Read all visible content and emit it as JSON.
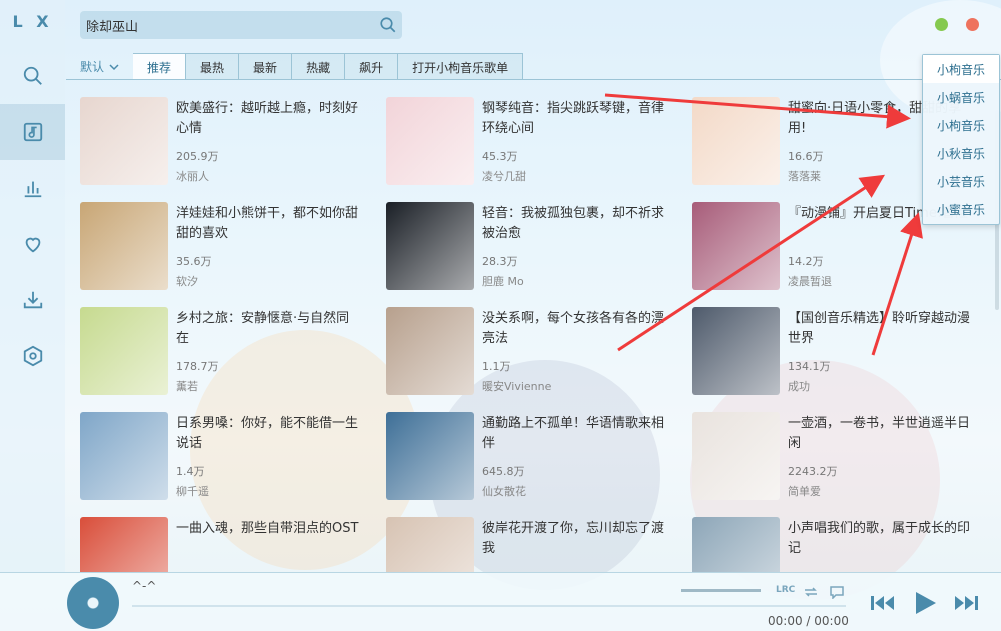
{
  "app": {
    "logo": "L X"
  },
  "search": {
    "value": "除却巫山"
  },
  "tabs": {
    "sort_label": "默认",
    "items": [
      "推荐",
      "最热",
      "最新",
      "热藏",
      "飙升",
      "打开小枸音乐歌单"
    ]
  },
  "source_menu": [
    "小枸音乐",
    "小蜗音乐",
    "小枸音乐",
    "小秋音乐",
    "小芸音乐",
    "小蜜音乐"
  ],
  "playlists": [
    {
      "title": "欧美盛行：越听越上瘾，时刻好心情",
      "count": "205.9万",
      "author": "冰丽人",
      "color": "#e7d6cf"
    },
    {
      "title": "钢琴纯音：指尖跳跃琴键，音律环绕心间",
      "count": "45.3万",
      "author": "凌兮几甜",
      "color": "#f2d4d9"
    },
    {
      "title": "甜蜜向·日语小零食，甜甜的享用!",
      "count": "16.6万",
      "author": "落落莱",
      "color": "#f3d9c7"
    },
    {
      "title": "洋娃娃和小熊饼干，都不如你甜甜的喜欢",
      "count": "35.6万",
      "author": "软汐",
      "color": "#c8a675"
    },
    {
      "title": "轻音：我被孤独包裹，却不祈求被治愈",
      "count": "28.3万",
      "author": "胆鹿 Mo",
      "color": "#1a1f26"
    },
    {
      "title": "『动漫铺』开启夏日Time!冒险",
      "count": "14.2万",
      "author": "凌晨暂退",
      "color": "#a75c79"
    },
    {
      "title": "乡村之旅：安静惬意·与自然同在",
      "count": "178.7万",
      "author": "薰若",
      "color": "#c6da8f"
    },
    {
      "title": "没关系啊，每个女孩各有各的漂亮法",
      "count": "1.1万",
      "author": "暖安Vivienne",
      "color": "#b7a08d"
    },
    {
      "title": "【国创音乐精选】聆听穿越动漫世界",
      "count": "134.1万",
      "author": "成功",
      "color": "#4e5a6b"
    },
    {
      "title": "日系男嗓：你好，能不能借一生说话",
      "count": "1.4万",
      "author": "柳千遥",
      "color": "#7fa6c8"
    },
    {
      "title": "通勤路上不孤单！华语情歌来相伴",
      "count": "645.8万",
      "author": "仙女散花",
      "color": "#3e6f97"
    },
    {
      "title": "一壶酒，一卷书，半世逍遥半日闲",
      "count": "2243.2万",
      "author": "简单爱",
      "color": "#e9e3de"
    },
    {
      "title": "一曲入魂，那些自带泪点的OST",
      "count": "",
      "author": "",
      "color": "#d94e3a"
    },
    {
      "title": "彼岸花开渡了你，忘川却忘了渡我",
      "count": "",
      "author": "",
      "color": "#d7c3b3"
    },
    {
      "title": "小声唱我们的歌，属于成长的印记",
      "count": "",
      "author": "",
      "color": "#8da6b8"
    }
  ],
  "player": {
    "song": "^-^",
    "time": "00:00 / 00:00",
    "lrc_label": "LRC"
  },
  "colors": {
    "accent": "#4a8bab",
    "annotation": "#ef3b3b"
  }
}
